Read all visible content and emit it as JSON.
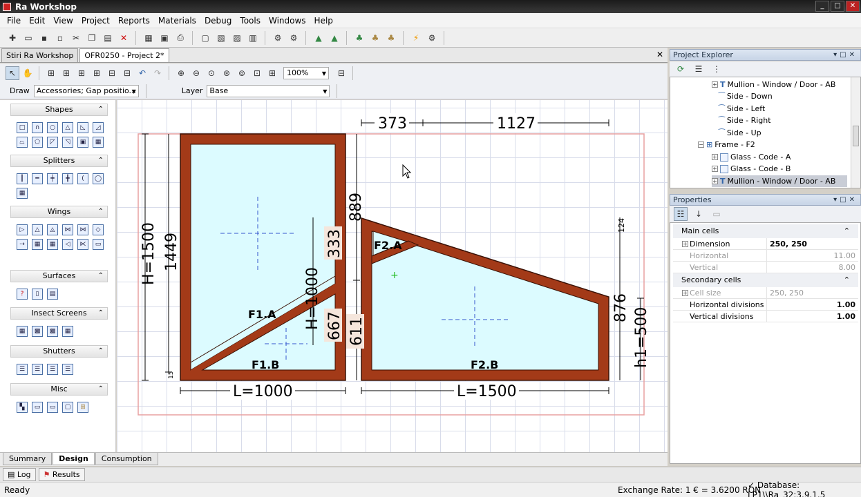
{
  "window": {
    "title": "Ra Workshop",
    "min": "_",
    "max": "□",
    "close": "✕"
  },
  "menu": [
    "File",
    "Edit",
    "View",
    "Project",
    "Reports",
    "Materials",
    "Debug",
    "Tools",
    "Windows",
    "Help"
  ],
  "doc_tabs": {
    "tab1": "Stiri Ra Workshop",
    "tab2": "OFR0250 - Project 2*",
    "close": "✕"
  },
  "design_toolbar": {
    "zoom": "100%",
    "draw_label": "Draw",
    "draw_value": "Accessories; Gap positio...",
    "layer_label": "Layer",
    "layer_value": "Base"
  },
  "palette": {
    "shapes": "Shapes",
    "splitters": "Splitters",
    "wings": "Wings",
    "surfaces": "Surfaces",
    "insect_screens": "Insect Screens",
    "shutters": "Shutters",
    "misc": "Misc",
    "collapse": "⌃"
  },
  "drawing": {
    "dim_373": "373",
    "dim_1127": "1127",
    "dim_889": "889",
    "dim_333": "333",
    "dim_667": "667",
    "dim_611": "611",
    "dim_876": "876",
    "dim_124": "124",
    "dim_15": "15",
    "h1500": "H=1500",
    "h1449": "1449",
    "h1000": "H=1000",
    "h1_500": "h1=500",
    "l1000": "L=1000",
    "l1500": "L=1500",
    "f1a": "F1.A",
    "f1b": "F1.B",
    "f2a": "F2.A",
    "f2b": "F2.B"
  },
  "bottom_tabs": {
    "summary": "Summary",
    "design": "Design",
    "consumption": "Consumption"
  },
  "log_tabs": {
    "log": "Log",
    "results": "Results"
  },
  "status": {
    "ready": "Ready",
    "exchange": "Exchange Rate: 1 € = 3.6200 RON",
    "database": "✓ Database: LP1\\\\Ra_32:3.9.1.5"
  },
  "project_explorer": {
    "title": "Project Explorer",
    "nodes": [
      "Mullion - Window / Door - AB",
      "Side - Down",
      "Side - Left",
      "Side - Right",
      "Side - Up",
      "Frame - F2",
      "Glass - Code - A",
      "Glass - Code - B",
      "Mullion - Window / Door - AB"
    ]
  },
  "properties": {
    "title": "Properties",
    "main_cells": "Main cells",
    "dimension_label": "Dimension",
    "dimension_value": "250, 250",
    "horizontal_label": "Horizontal",
    "horizontal_value": "11.00",
    "vertical_label": "Vertical",
    "vertical_value": "8.00",
    "secondary_cells": "Secondary cells",
    "cell_size_label": "Cell size",
    "cell_size_value": "250, 250",
    "hdiv_label": "Horizontal divisions",
    "hdiv_value": "1.00",
    "vdiv_label": "Vertical divisions",
    "vdiv_value": "1.00"
  },
  "colors": {
    "frame": "#a33a18",
    "glass": "#dcfbff",
    "accent": "#0a246a"
  }
}
